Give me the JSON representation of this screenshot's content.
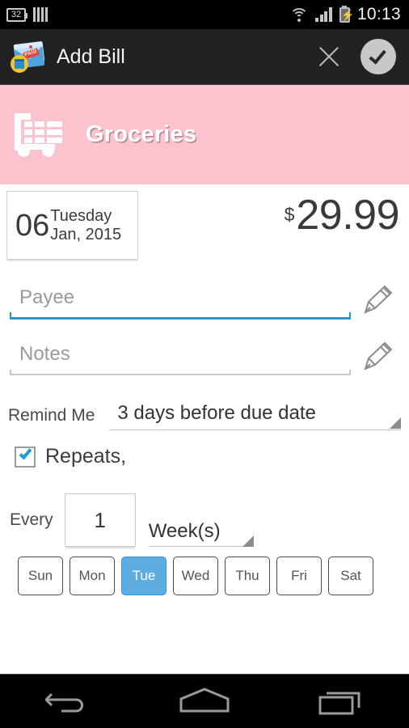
{
  "status_bar": {
    "time": "10:13",
    "icons": [
      "notification-count-icon",
      "signal-bars-icon",
      "wifi-icon",
      "cellular-signal-icon",
      "battery-charging-icon"
    ],
    "notification_count": "32"
  },
  "action_bar": {
    "app_icon": "paid-bill-envelope-icon",
    "title": "Add Bill",
    "close_label": "close-icon",
    "accept_label": "accept-check-icon"
  },
  "banner": {
    "icon": "shopping-cart-icon",
    "category": "Groceries",
    "background_color": "#fbc3cd"
  },
  "due_date": {
    "day": "06",
    "weekday": "Tuesday",
    "month_year": "Jan, 2015"
  },
  "amount": {
    "currency_symbol": "$",
    "value": "29.99"
  },
  "fields": {
    "payee": {
      "label": "Payee",
      "value": "",
      "placeholder": "Payee",
      "edit_icon": "pencil-icon"
    },
    "notes": {
      "label": "Notes",
      "value": "",
      "placeholder": "Notes",
      "edit_icon": "pencil-icon"
    }
  },
  "remind": {
    "label": "Remind Me",
    "selected": "3 days before due date"
  },
  "repeats": {
    "label": "Repeats,",
    "checked": true,
    "accent_color": "#1a9bd7"
  },
  "recurrence": {
    "every_label": "Every",
    "interval": "1",
    "period": "Week(s)",
    "days": [
      {
        "label": "Sun",
        "selected": false
      },
      {
        "label": "Mon",
        "selected": false
      },
      {
        "label": "Tue",
        "selected": true
      },
      {
        "label": "Wed",
        "selected": false
      },
      {
        "label": "Thu",
        "selected": false
      },
      {
        "label": "Fri",
        "selected": false
      },
      {
        "label": "Sat",
        "selected": false
      }
    ],
    "selected_color": "#5dade2"
  },
  "nav_bar": {
    "back": "back-icon",
    "home": "home-icon",
    "recents": "recent-apps-icon"
  }
}
